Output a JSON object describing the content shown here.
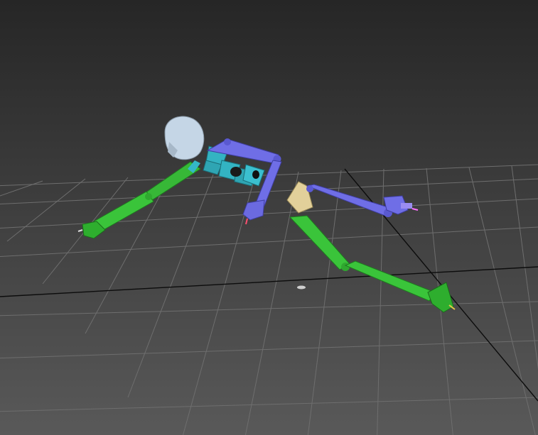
{
  "viewport": {
    "kind": "3d-perspective-viewport",
    "background_top": "#262626",
    "background_bottom": "#595959",
    "grid_color": "#6e6e6e",
    "axis_color": "#0c0c0c"
  },
  "rig": {
    "name": "biped-skeleton",
    "pose": "crawling",
    "colors": {
      "head": "#c5d6e6",
      "spine": "#33b3c2",
      "left_side_blue": "#6f6ee6",
      "right_side_green": "#3ac43a",
      "pelvis": "#e2d09a",
      "pivot_marker": "#ff70ff"
    }
  }
}
